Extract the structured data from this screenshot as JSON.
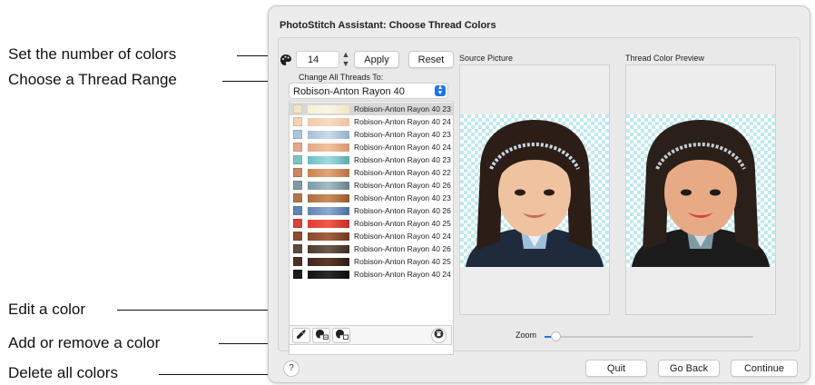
{
  "callouts": {
    "set_number": "Set the number of colors",
    "thread_range": "Choose a Thread Range",
    "edit_color": "Edit a color",
    "add_remove": "Add or remove a color",
    "delete_all": "Delete all colors"
  },
  "window": {
    "title": "PhotoStitch Assistant: Choose Thread Colors",
    "color_count": "14",
    "apply_label": "Apply",
    "reset_label": "Reset",
    "change_all_label": "Change All Threads To:",
    "thread_range_selected": "Robison-Anton Rayon 40",
    "source_picture_label": "Source Picture",
    "preview_label": "Thread Color Preview",
    "zoom_label": "Zoom",
    "zoom_level": 0.02,
    "help_label": "?",
    "quit_label": "Quit",
    "go_back_label": "Go Back",
    "continue_label": "Continue"
  },
  "threads": [
    {
      "name": "Robison-Anton Rayon 40 23",
      "swatch": "#f5e6c2",
      "bar": [
        "#f7f0d4",
        "#fbf6e4",
        "#f1e5bf"
      ],
      "selected": true
    },
    {
      "name": "Robison-Anton Rayon 40 24",
      "swatch": "#f3d3b3",
      "bar": [
        "#f1c8ae",
        "#f7dcc3",
        "#eec0a2"
      ],
      "selected": false
    },
    {
      "name": "Robison-Anton Rayon 40 23",
      "swatch": "#a9c6d6",
      "bar": [
        "#a3bfd6",
        "#c9dbe8",
        "#8fb0cb"
      ],
      "selected": false
    },
    {
      "name": "Robison-Anton Rayon 40 24",
      "swatch": "#e1a88a",
      "bar": [
        "#e2a986",
        "#f0c29f",
        "#d9966f"
      ],
      "selected": false
    },
    {
      "name": "Robison-Anton Rayon 40 23",
      "swatch": "#7ec3c8",
      "bar": [
        "#6bbcc4",
        "#a1dbe0",
        "#5aa9b3"
      ],
      "selected": false
    },
    {
      "name": "Robison-Anton Rayon 40 22",
      "swatch": "#c9875f",
      "bar": [
        "#c98253",
        "#e0a478",
        "#b77144"
      ],
      "selected": false
    },
    {
      "name": "Robison-Anton Rayon 40 26",
      "swatch": "#7f9aa3",
      "bar": [
        "#7e98a4",
        "#a7bcc4",
        "#64808c"
      ],
      "selected": false
    },
    {
      "name": "Robison-Anton Rayon 40 23",
      "swatch": "#b2764a",
      "bar": [
        "#a86e43",
        "#c98d5e",
        "#93592f"
      ],
      "selected": false
    },
    {
      "name": "Robison-Anton Rayon 40 26",
      "swatch": "#5f86b2",
      "bar": [
        "#5f85b5",
        "#8aaad2",
        "#4b6e9c"
      ],
      "selected": false
    },
    {
      "name": "Robison-Anton Rayon 40 25",
      "swatch": "#d8433a",
      "bar": [
        "#e03b30",
        "#f05a4a",
        "#c22c22"
      ],
      "selected": false
    },
    {
      "name": "Robison-Anton Rayon 40 24",
      "swatch": "#8a4c32",
      "bar": [
        "#86472c",
        "#a5613f",
        "#6d3820"
      ],
      "selected": false
    },
    {
      "name": "Robison-Anton Rayon 40 26",
      "swatch": "#5b4a3e",
      "bar": [
        "#4a3b32",
        "#6e5a4b",
        "#3a2e26"
      ],
      "selected": false
    },
    {
      "name": "Robison-Anton Rayon 40 25",
      "swatch": "#4a3024",
      "bar": [
        "#3d271c",
        "#5a3a2a",
        "#2e1c13"
      ],
      "selected": false
    },
    {
      "name": "Robison-Anton Rayon 40 24",
      "swatch": "#1b1b1b",
      "bar": [
        "#141414",
        "#2a2a2a",
        "#0c0c0c"
      ],
      "selected": false
    }
  ],
  "toolbar_icons": {
    "edit": "eyedropper-icon",
    "add_remove": "palette-add-remove-icon",
    "remove": "palette-remove-icon",
    "delete_all": "trash-icon"
  },
  "colors": {
    "accent": "#1e74e8",
    "checker_a": "#bfe9f0",
    "checker_b": "#ffffff"
  }
}
